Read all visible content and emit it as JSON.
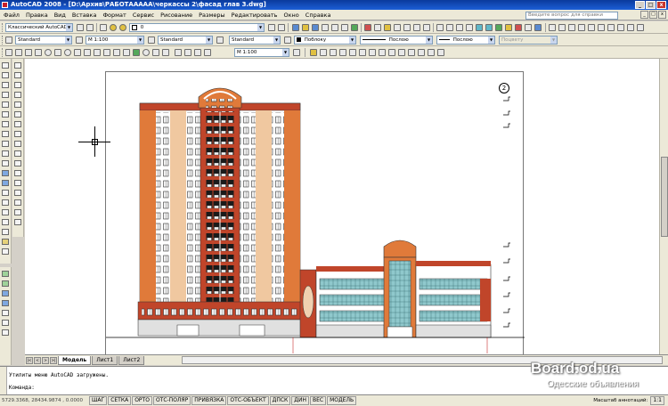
{
  "window": {
    "title": "AutoCAD 2008 - [D:\\Архив\\РАБОТААААА\\черкассы 2\\фасад глав 3.dwg]",
    "controls": [
      "_",
      "□",
      "x"
    ]
  },
  "menu": [
    "Файл",
    "Правка",
    "Вид",
    "Вставка",
    "Формат",
    "Сервис",
    "Рисование",
    "Размеры",
    "Редактировать",
    "Окно",
    "Справка"
  ],
  "help_search": {
    "placeholder": "Введите вопрос для справки"
  },
  "toolbar1": {
    "workspace": "Классический AutoCAD",
    "layer_value": "0"
  },
  "toolbar2": {
    "text_style": "Standard",
    "dim_scale": "M 1:100",
    "dim_style": "Standard",
    "table_style": "Standard",
    "color": "Поблоку",
    "linetype": "Послою",
    "lineweight": "Послою",
    "plotstyle": "Поцвету"
  },
  "toolbar3": {
    "scale": "M 1:100"
  },
  "drawing": {
    "view_number": "2"
  },
  "sheet_tabs": {
    "nav": [
      "|<",
      "<",
      ">",
      ">|"
    ],
    "tabs": [
      "Модель",
      "Лист1",
      "Лист2"
    ]
  },
  "command": {
    "history_line": "Утилиты меню AutoCAD загружены.",
    "prompt": "Команда:"
  },
  "status": {
    "coords": "5729.3368, 28434.9874 , 0.0000",
    "buttons": [
      "ШАГ",
      "СЕТКА",
      "ОРТО",
      "ОТС-ПОЛЯР",
      "ПРИВЯЗКА",
      "ОТС-ОБЪЕКТ",
      "ДПСК",
      "ДИН",
      "ВЕС",
      "МОДЕЛЬ"
    ],
    "annotation_scale_label": "Масштаб аннотаций:",
    "annotation_scale": "1:1"
  },
  "watermark": {
    "site": "Board.od.ua",
    "caption": "Одесские объявления"
  },
  "colors": {
    "title_bar": "#1c5fd6",
    "brick": "#c0452a",
    "orange": "#e07a3a",
    "glass": "#8fc8cc"
  }
}
